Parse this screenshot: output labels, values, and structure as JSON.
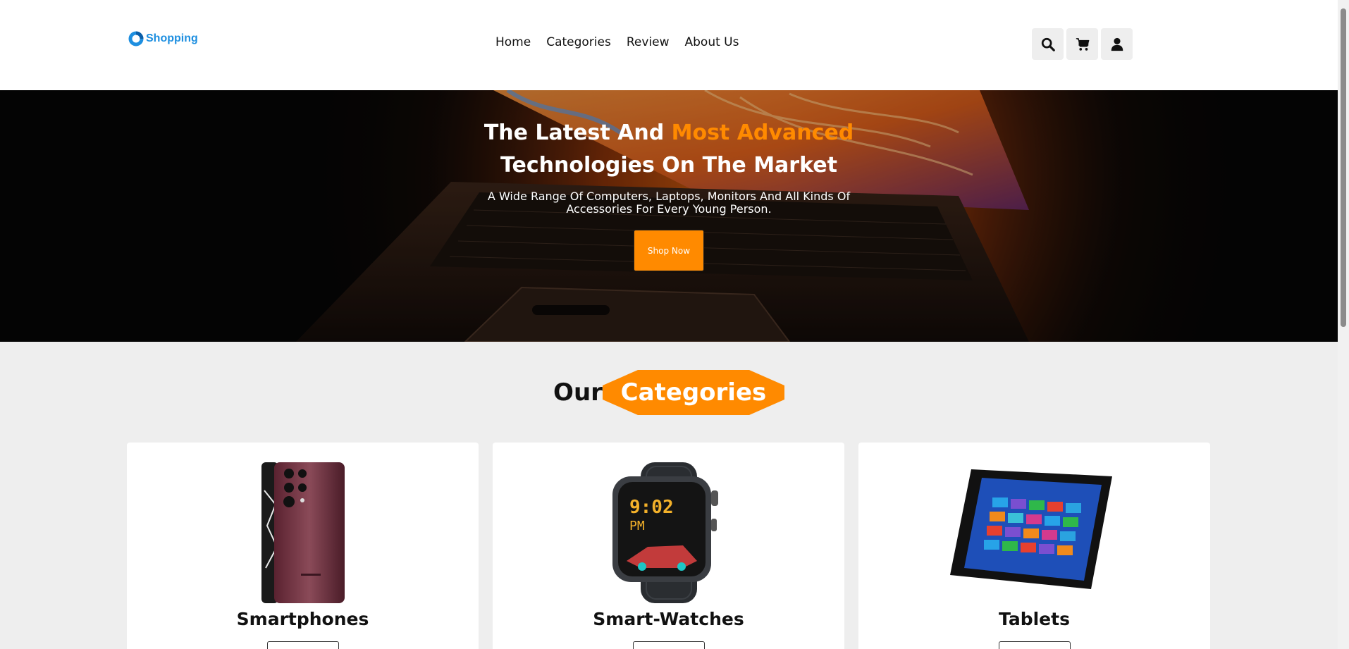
{
  "header": {
    "logo_text": "Shopping",
    "nav": [
      "Home",
      "Categories",
      "Review",
      "About Us"
    ],
    "icons": [
      "search-icon",
      "cart-icon",
      "user-icon"
    ]
  },
  "hero": {
    "title_part1": "The Latest And ",
    "title_accent": "Most Advanced",
    "title_part2": "Technologies On The Market",
    "subtitle": "A Wide Range Of Computers, Laptops, Monitors And All Kinds Of Accessories For Every Young Person.",
    "button_label": "Shop Now"
  },
  "categories": {
    "heading_plain": "Our",
    "heading_accent": "Categories",
    "items": [
      {
        "name": "Smartphones",
        "image": "smartphone-image"
      },
      {
        "name": "Smart-Watches",
        "image": "smartwatch-image",
        "watch_time": "9:02",
        "watch_ampm": "PM"
      },
      {
        "name": "Tablets",
        "image": "tablet-image"
      }
    ]
  },
  "colors": {
    "accent": "#ff8a00",
    "logo_blue": "#1e8fe0",
    "page_bg": "#eeeeee"
  }
}
